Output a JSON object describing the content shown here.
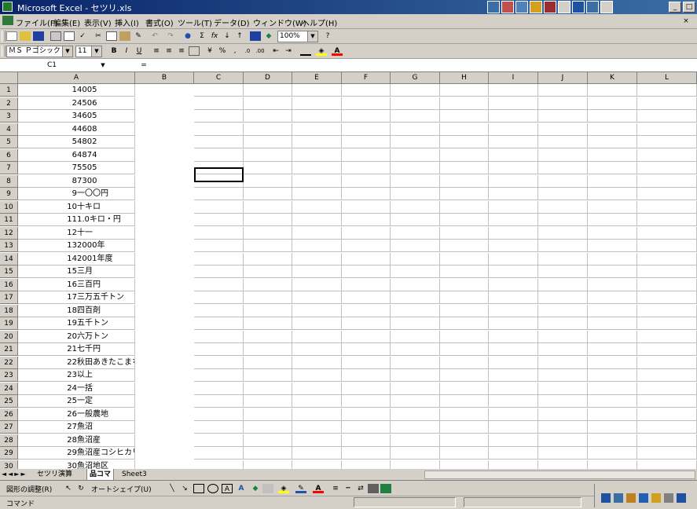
{
  "window": {
    "title": "Microsoft Excel - セツリ.xls",
    "accent": "#0a246a"
  },
  "menu": [
    "ファイル(F)",
    "編集(E)",
    "表示(V)",
    "挿入(I)",
    "書式(O)",
    "ツール(T)",
    "データ(D)",
    "ウィンドウ(W)",
    "ヘルプ(H)"
  ],
  "toolbar": {
    "zoom": "100%",
    "font_name": "ＭＳ Ｐゴシック",
    "font_size": "11"
  },
  "formula_bar": {
    "name_box": "C1",
    "content": ""
  },
  "grid": {
    "selected_cell": "C1",
    "col_headers": [
      "A",
      "B",
      "C",
      "D",
      "E",
      "F",
      "G",
      "H",
      "I",
      "J",
      "K",
      "L"
    ],
    "rows": [
      {
        "r": "1",
        "n": "1",
        "t": "4005"
      },
      {
        "r": "2",
        "n": "2",
        "t": "4506"
      },
      {
        "r": "3",
        "n": "3",
        "t": "4605"
      },
      {
        "r": "4",
        "n": "4",
        "t": "4608"
      },
      {
        "r": "5",
        "n": "5",
        "t": "4802"
      },
      {
        "r": "6",
        "n": "6",
        "t": "4874"
      },
      {
        "r": "7",
        "n": "7",
        "t": "5505"
      },
      {
        "r": "8",
        "n": "8",
        "t": "7300"
      },
      {
        "r": "9",
        "n": "9",
        "t": "一〇〇円"
      },
      {
        "r": "10",
        "n": "10",
        "t": "十キロ"
      },
      {
        "r": "11",
        "n": "11",
        "t": "1.0キロ・円"
      },
      {
        "r": "12",
        "n": "12",
        "t": "十一"
      },
      {
        "r": "13",
        "n": "13",
        "t": "2000年"
      },
      {
        "r": "14",
        "n": "14",
        "t": "2001年度"
      },
      {
        "r": "15",
        "n": "15",
        "t": "三月"
      },
      {
        "r": "16",
        "n": "16",
        "t": "三百円"
      },
      {
        "r": "17",
        "n": "17",
        "t": "三万五千トン"
      },
      {
        "r": "18",
        "n": "18",
        "t": "四百剤"
      },
      {
        "r": "19",
        "n": "19",
        "t": "五千トン"
      },
      {
        "r": "20",
        "n": "20",
        "t": "六万トン"
      },
      {
        "r": "21",
        "n": "21",
        "t": "七千円"
      },
      {
        "r": "22",
        "n": "22",
        "t": "秋田あきたこまち"
      },
      {
        "r": "23",
        "n": "23",
        "t": "以上"
      },
      {
        "r": "24",
        "n": "24",
        "t": "一括"
      },
      {
        "r": "25",
        "n": "25",
        "t": "一定"
      },
      {
        "r": "26",
        "n": "26",
        "t": "一般農地"
      },
      {
        "r": "27",
        "n": "27",
        "t": "魚沼"
      },
      {
        "r": "28",
        "n": "28",
        "t": "魚沼産"
      },
      {
        "r": "29",
        "n": "29",
        "t": "魚沼産コシヒカリ"
      },
      {
        "r": "30",
        "n": "30",
        "t": "魚沼地区"
      }
    ]
  },
  "sheet_tabs": [
    "セツリ演算",
    "品コマ",
    "Sheet3"
  ],
  "drawing_toolbar": {
    "draw_menu": "図形の調整(R)",
    "autoshapes": "オートシェイプ(U)"
  },
  "status": "コマンド"
}
